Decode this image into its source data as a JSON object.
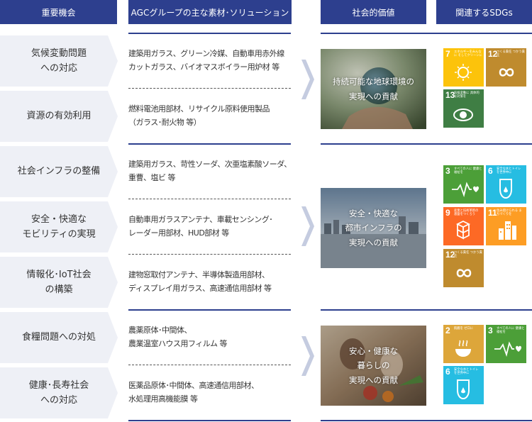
{
  "headers": {
    "issues": "重要機会",
    "solutions": "AGCグループの主な素材･ソリューション",
    "value": "社会的価値",
    "sdgs": "関連するSDGs"
  },
  "issues": [
    {
      "label": "気候変動問題への対応",
      "line1": "気候変動問題",
      "line2": "への対応"
    },
    {
      "label": "資源の有効利用",
      "line1": "資源の有効利用",
      "line2": ""
    },
    {
      "label": "社会インフラの整備",
      "line1": "社会インフラの整備",
      "line2": ""
    },
    {
      "label": "安全・快適なモビリティの実現",
      "line1": "安全・快適な",
      "line2": "モビリティの実現"
    },
    {
      "label": "情報化・IoT社会の構築",
      "line1": "情報化･IoT社会",
      "line2": "の構築"
    },
    {
      "label": "食糧問題への対処",
      "line1": "食糧問題への対処",
      "line2": ""
    },
    {
      "label": "健康・長寿社会への対応",
      "line1": "健康･長寿社会",
      "line2": "への対応"
    }
  ],
  "solutions": [
    {
      "line1": "建築用ガラス、グリーン冷媒、自動車用赤外線",
      "line2": "カットガラス、バイオマスボイラー用炉材 等"
    },
    {
      "line1": "燃料電池用部材、リサイクル原料使用製品",
      "line2": "（ガラス･耐火物 等）"
    },
    {
      "line1": "建築用ガラス、苛性ソーダ、次亜塩素酸ソーダ、",
      "line2": "重曹、塩ビ 等"
    },
    {
      "line1": "自動車用ガラスアンテナ、車載センシング･",
      "line2": "レーダー用部材、HUD部材 等"
    },
    {
      "line1": "建物窓取付アンテナ、半導体製造用部材、",
      "line2": "ディスプレイ用ガラス、高速通信用部材 等"
    },
    {
      "line1": "農薬原体･中間体、",
      "line2": "農業温室ハウス用フィルム 等"
    },
    {
      "line1": "医薬品原体･中間体、高速通信用部材、",
      "line2": "水処理用高機能膜 等"
    }
  ],
  "values": [
    {
      "line1": "持続可能な地球環境の",
      "line2": "実現への貢献",
      "line3": ""
    },
    {
      "line1": "安全・快適な",
      "line2": "都市インフラの",
      "line3": "実現への貢献"
    },
    {
      "line1": "安心・健康な",
      "line2": "暮らしの",
      "line3": "実現への貢献"
    }
  ],
  "sdg_goals": [
    {
      "number": "7",
      "label": "エネルギーをみんなに そしてクリーンに",
      "color": "#fcc30b",
      "icon": "sun-icon"
    },
    {
      "number": "12",
      "label": "つくる責任 つかう責任",
      "color": "#bf8b2e",
      "icon": "infinity-icon"
    },
    {
      "number": "13",
      "label": "気候変動に 具体的な対策を",
      "color": "#3f7e44",
      "icon": "eye-globe-icon"
    },
    {
      "number": "3",
      "label": "すべての人に 健康と福祉を",
      "color": "#4c9f38",
      "icon": "heartbeat-icon"
    },
    {
      "number": "6",
      "label": "安全な水とトイレ を世界中に",
      "color": "#26bde2",
      "icon": "water-drop-icon"
    },
    {
      "number": "9",
      "label": "産業と技術革新の 基盤をつくろう",
      "color": "#fd6925",
      "icon": "cubes-icon"
    },
    {
      "number": "11",
      "label": "住み続けられる まちづくりを",
      "color": "#fd9d24",
      "icon": "city-icon"
    },
    {
      "number": "12",
      "label": "つくる責任 つかう責任",
      "color": "#bf8b2e",
      "icon": "infinity-icon"
    },
    {
      "number": "2",
      "label": "飢餓を ゼロに",
      "color": "#dda63a",
      "icon": "bowl-icon"
    },
    {
      "number": "3",
      "label": "すべての人に 健康と福祉を",
      "color": "#4c9f38",
      "icon": "heartbeat-icon"
    },
    {
      "number": "6",
      "label": "安全な水とトイレ を世界中に",
      "color": "#26bde2",
      "icon": "water-drop-icon"
    }
  ],
  "colors": {
    "header": "#2d3f8e",
    "issue_bg": "#eef0f6",
    "chevron": "#c5cce0"
  }
}
